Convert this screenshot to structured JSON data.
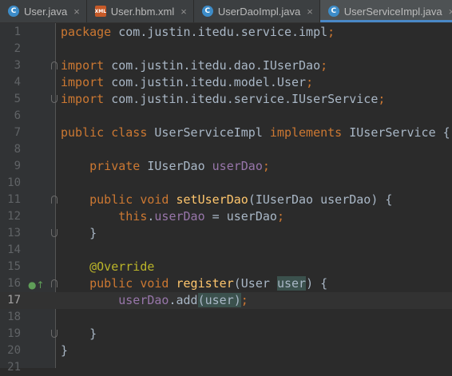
{
  "tabs": [
    {
      "label": "User.java",
      "icon": "class-icon",
      "icon_letter": "C",
      "icon_color": "#3d8cc8",
      "active": false
    },
    {
      "label": "User.hbm.xml",
      "icon": "xml-file-icon",
      "icon_letter": "XML",
      "icon_color": "#c75a28",
      "active": false
    },
    {
      "label": "UserDaoImpl.java",
      "icon": "class-icon",
      "icon_letter": "C",
      "icon_color": "#3d8cc8",
      "active": false
    },
    {
      "label": "UserServiceImpl.java",
      "icon": "class-icon",
      "icon_letter": "C",
      "icon_color": "#3d8cc8",
      "active": true
    }
  ],
  "close_glyph": "×",
  "current_line": 17,
  "lines": [
    {
      "n": "1",
      "tokens": [
        [
          "kw",
          "package"
        ],
        [
          "t",
          " com.justin.itedu.service.impl"
        ],
        [
          "kw",
          ";"
        ]
      ]
    },
    {
      "n": "2",
      "tokens": []
    },
    {
      "n": "3",
      "fold": "down",
      "tokens": [
        [
          "kw",
          "import"
        ],
        [
          "t",
          " com.justin.itedu.dao.IUserDao"
        ],
        [
          "kw",
          ";"
        ]
      ]
    },
    {
      "n": "4",
      "tokens": [
        [
          "kw",
          "import"
        ],
        [
          "t",
          " com.justin.itedu.model.User"
        ],
        [
          "kw",
          ";"
        ]
      ]
    },
    {
      "n": "5",
      "fold": "up",
      "tokens": [
        [
          "kw",
          "import"
        ],
        [
          "t",
          " com.justin.itedu.service.IUserService"
        ],
        [
          "kw",
          ";"
        ]
      ]
    },
    {
      "n": "6",
      "tokens": []
    },
    {
      "n": "7",
      "tokens": [
        [
          "kw",
          "public class"
        ],
        [
          "t",
          " UserServiceImpl "
        ],
        [
          "kw",
          "implements"
        ],
        [
          "t",
          " IUserService {"
        ]
      ]
    },
    {
      "n": "8",
      "tokens": []
    },
    {
      "n": "9",
      "tokens": [
        [
          "t",
          "    "
        ],
        [
          "kw",
          "private"
        ],
        [
          "t",
          " IUserDao "
        ],
        [
          "fld",
          "userDao"
        ],
        [
          "kw",
          ";"
        ]
      ]
    },
    {
      "n": "10",
      "tokens": []
    },
    {
      "n": "11",
      "fold": "down",
      "tokens": [
        [
          "t",
          "    "
        ],
        [
          "kw",
          "public void"
        ],
        [
          "t",
          " "
        ],
        [
          "mth",
          "setUserDao"
        ],
        [
          "t",
          "(IUserDao userDao) {"
        ]
      ]
    },
    {
      "n": "12",
      "tokens": [
        [
          "t",
          "        "
        ],
        [
          "kw",
          "this"
        ],
        [
          "t",
          "."
        ],
        [
          "fld",
          "userDao"
        ],
        [
          "t",
          " = userDao"
        ],
        [
          "kw",
          ";"
        ]
      ]
    },
    {
      "n": "13",
      "fold": "up",
      "tokens": [
        [
          "t",
          "    }"
        ]
      ]
    },
    {
      "n": "14",
      "tokens": []
    },
    {
      "n": "15",
      "tokens": [
        [
          "t",
          "    "
        ],
        [
          "ann",
          "@Override"
        ]
      ]
    },
    {
      "n": "16",
      "fold": "down",
      "mark": "implementing-method-icon",
      "mark_glyph": "●↑",
      "tokens": [
        [
          "t",
          "    "
        ],
        [
          "kw",
          "public void"
        ],
        [
          "t",
          " "
        ],
        [
          "mth",
          "register"
        ],
        [
          "t",
          "(User "
        ],
        [
          "hl",
          "user"
        ],
        [
          "t",
          ") {"
        ]
      ]
    },
    {
      "n": "17",
      "tokens": [
        [
          "t",
          "        "
        ],
        [
          "fld",
          "userDao"
        ],
        [
          "t",
          ".add"
        ],
        [
          "hl",
          "("
        ],
        [
          "hl",
          "user"
        ],
        [
          "hl",
          ")"
        ],
        [
          "kw",
          ";"
        ]
      ]
    },
    {
      "n": "18",
      "tokens": []
    },
    {
      "n": "19",
      "fold": "up",
      "tokens": [
        [
          "t",
          "    }"
        ]
      ]
    },
    {
      "n": "20",
      "tokens": [
        [
          "t",
          "}"
        ]
      ]
    },
    {
      "n": "21",
      "tokens": []
    }
  ]
}
